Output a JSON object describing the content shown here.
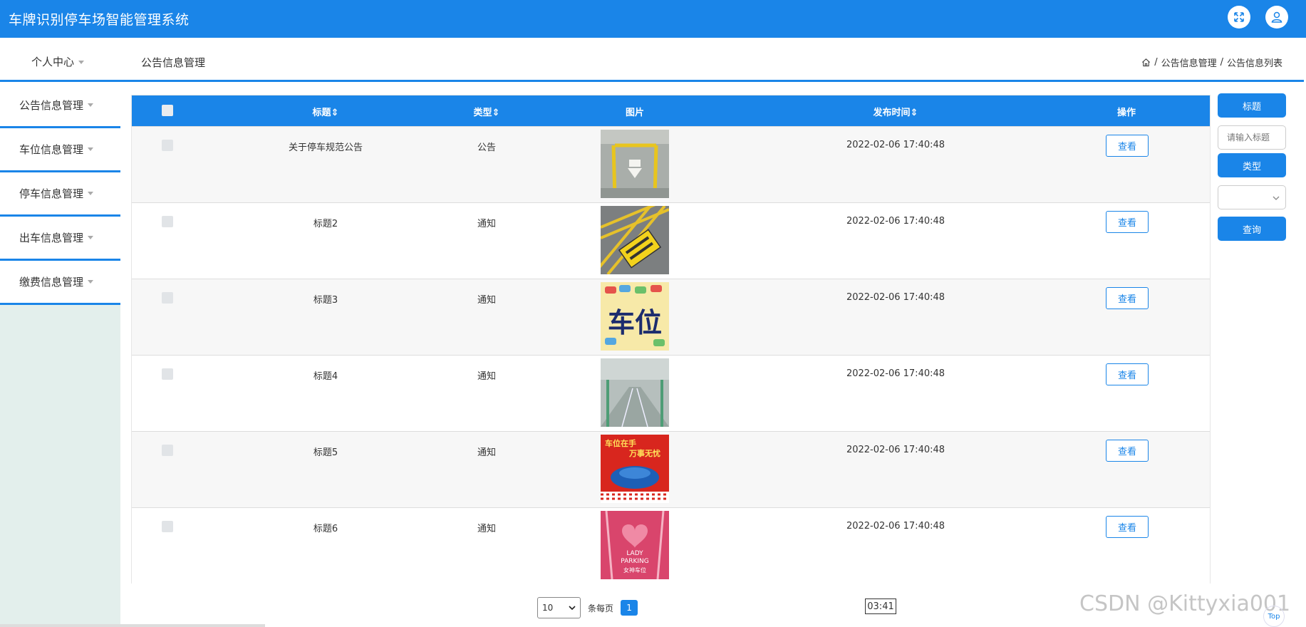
{
  "app": {
    "title": "车牌识别停车场智能管理系统"
  },
  "header": {
    "personal_center": "个人中心",
    "page_heading": "公告信息管理"
  },
  "breadcrumb": {
    "items": [
      "公告信息管理",
      "公告信息列表"
    ]
  },
  "sidebar": {
    "items": [
      "公告信息管理",
      "车位信息管理",
      "停车信息管理",
      "出车信息管理",
      "缴费信息管理"
    ]
  },
  "table": {
    "columns": [
      "标题",
      "类型",
      "图片",
      "发布时间",
      "操作"
    ],
    "view_label": "查看",
    "rows": [
      {
        "title": "关于停车规范公告",
        "type": "公告",
        "time": "2022-02-06 17:40:48"
      },
      {
        "title": "标题2",
        "type": "通知",
        "time": "2022-02-06 17:40:48"
      },
      {
        "title": "标题3",
        "type": "通知",
        "time": "2022-02-06 17:40:48"
      },
      {
        "title": "标题4",
        "type": "通知",
        "time": "2022-02-06 17:40:48"
      },
      {
        "title": "标题5",
        "type": "通知",
        "time": "2022-02-06 17:40:48"
      },
      {
        "title": "标题6",
        "type": "通知",
        "time": "2022-02-06 17:40:48"
      }
    ]
  },
  "thumbs": {
    "t3": "车位",
    "t5a": "车位在手",
    "t5b": "万事无忧",
    "t6a": "LADY",
    "t6b": "PARKING",
    "t6c": "女神车位"
  },
  "filters": {
    "title_label": "标题",
    "title_placeholder": "请输入标题",
    "type_label": "类型",
    "query_label": "查询"
  },
  "pagination": {
    "page_size": "10",
    "per_page_label": "条每页",
    "current_page": "1"
  },
  "overlay": {
    "timer": "03:41",
    "watermark": "CSDN @Kittyxia001",
    "top_label": "Top"
  }
}
